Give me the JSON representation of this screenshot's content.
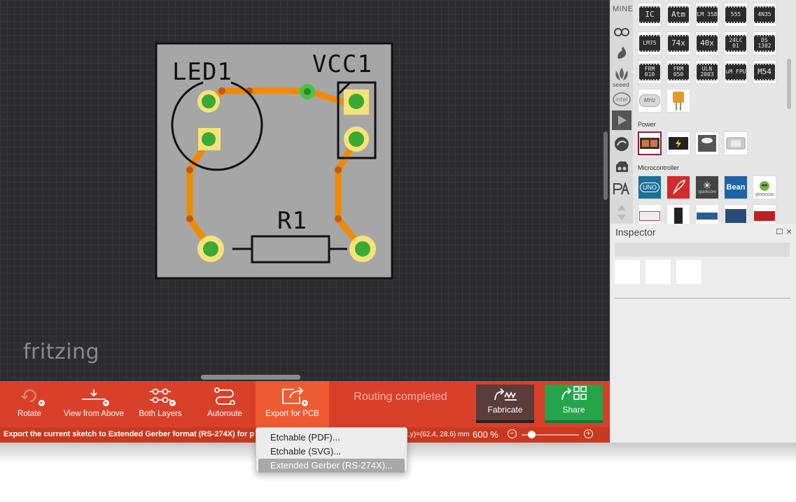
{
  "canvas": {
    "brand": "fritzing",
    "pcb": {
      "labels": {
        "led": "LED1",
        "vcc": "VCC1",
        "resistor": "R1"
      }
    }
  },
  "toolbar": {
    "rotate_label": "Rotate",
    "view_label": "View from Above",
    "layers_label": "Both Layers",
    "autoroute_label": "Autoroute",
    "export_label": "Export for PCB",
    "routing_status": "Routing completed",
    "fabricate_label": "Fabricate",
    "share_label": "Share"
  },
  "statusbar": {
    "message": "Export the current sketch to Extended Gerber format (RS-274X) for p",
    "coords": "x,y)=(62.4, 28.6) mm",
    "zoom": "600 %",
    "zoom_out": "−",
    "zoom_in": "+",
    "zoom_fraction": 0.18
  },
  "export_menu": {
    "items": [
      "Etchable (PDF)...",
      "Etchable (SVG)...",
      "Extended Gerber (RS-274X)..."
    ],
    "selected_index": 2
  },
  "parts_bin": {
    "mine_label": "MINE",
    "ic_parts": [
      "IC",
      "Atm",
      "LM 358",
      "555",
      "4N35",
      "LM75",
      "74x",
      "40x",
      "24LC 01",
      "DS 1302",
      "FRM 010",
      "FRM 050",
      "ULN 2003",
      "uM FPU",
      "M54",
      "MHz"
    ],
    "sections": {
      "power": "Power",
      "microcontroller": "Microcontroller"
    },
    "micro_parts": [
      "UNO",
      "Bean",
      "sparkcore",
      "pinoccio"
    ]
  },
  "inspector": {
    "title": "Inspector",
    "close": "×"
  },
  "colors": {
    "toolbar": "#d8402a",
    "export_active": "#ee5a32",
    "share": "#24a54a",
    "fabricate": "#5a3c3a",
    "trace": "#f28a00",
    "pad": "#f5e27a",
    "pad_center": "#3aaa35"
  }
}
